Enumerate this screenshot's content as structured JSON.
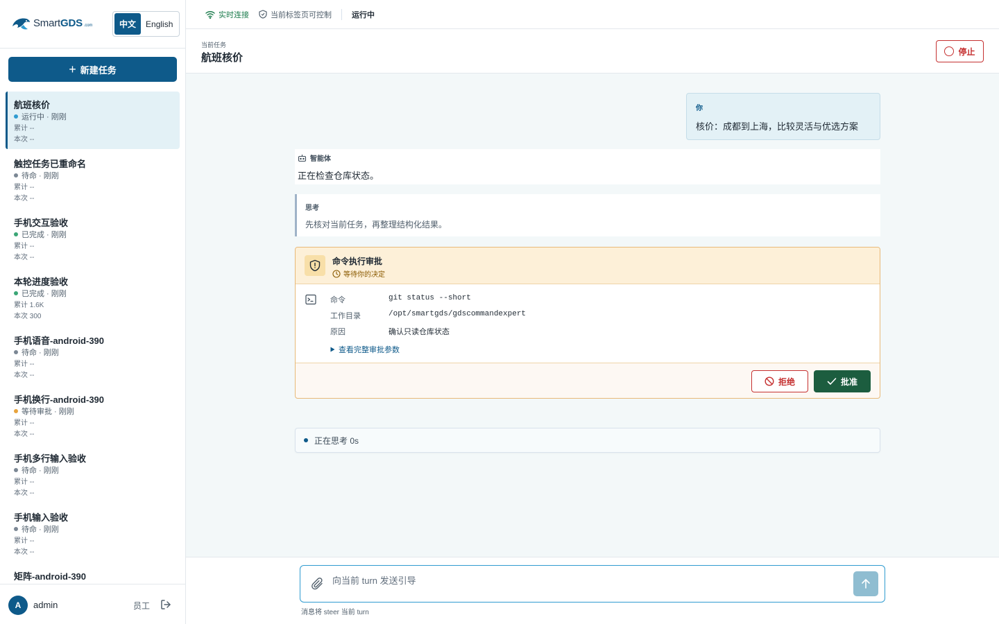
{
  "brand": {
    "name_prefix": "Smart",
    "name_bold": "GDS",
    "name_suffix": ".com"
  },
  "lang": {
    "zh": "中文",
    "en": "English"
  },
  "sidebar": {
    "new_task_label": "新建任务",
    "tasks": [
      {
        "title": "航班核价",
        "status": "运行中 · 刚刚",
        "status_color": "#2f9bd0",
        "total": "累计 --",
        "current": "本次 --"
      },
      {
        "title": "触控任务已重命名",
        "status": "待命 · 刚刚",
        "status_color": "#7b8794",
        "total": "累计 --",
        "current": "本次 --"
      },
      {
        "title": "手机交互验收",
        "status": "已完成 · 刚刚",
        "status_color": "#3ba676",
        "total": "累计 --",
        "current": "本次 --"
      },
      {
        "title": "本轮进度验收",
        "status": "已完成 · 刚刚",
        "status_color": "#3ba676",
        "total": "累计 1.6K",
        "current": "本次 300"
      },
      {
        "title": "手机语音-android-390",
        "status": "待命 · 刚刚",
        "status_color": "#7b8794",
        "total": "累计 --",
        "current": "本次 --"
      },
      {
        "title": "手机换行-android-390",
        "status": "等待审批 · 刚刚",
        "status_color": "#e8a33d",
        "total": "累计 --",
        "current": "本次 --"
      },
      {
        "title": "手机多行输入验收",
        "status": "待命 · 刚刚",
        "status_color": "#7b8794",
        "total": "累计 --",
        "current": "本次 --"
      },
      {
        "title": "手机输入验收",
        "status": "待命 · 刚刚",
        "status_color": "#7b8794",
        "total": "累计 --",
        "current": "本次 --"
      },
      {
        "title": "矩阵-android-390",
        "status": "",
        "status_color": "#7b8794",
        "total": "",
        "current": ""
      }
    ]
  },
  "user": {
    "avatar": "A",
    "name": "admin",
    "role": "员工"
  },
  "topbar": {
    "connection": "实时连接",
    "control": "当前标签页可控制",
    "state": "运行中"
  },
  "header": {
    "label": "当前任务",
    "title": "航班核价",
    "stop_label": "停止"
  },
  "chat": {
    "user_label": "你",
    "user_text": "核价：成都到上海，比较灵活与优选方案",
    "agent_label": "智能体",
    "agent_text": "正在检查仓库状态。",
    "think_label": "思考",
    "think_text": "先核对当前任务，再整理结构化结果。"
  },
  "approval": {
    "title": "命令执行审批",
    "subtitle": "等待你的决定",
    "command_key": "命令",
    "command_val": "git status --short",
    "cwd_key": "工作目录",
    "cwd_val": "/opt/smartgds/gdscommandexpert",
    "reason_key": "原因",
    "reason_val": "确认只读仓库状态",
    "more_label": "查看完整审批参数",
    "reject_label": "拒绝",
    "approve_label": "批准"
  },
  "status": {
    "thinking": "正在思考 0s"
  },
  "composer": {
    "placeholder": "向当前 turn 发送引导",
    "hint": "消息将 steer 当前 turn"
  },
  "colors": {
    "primary": "#0e5a8a",
    "danger": "#c53030",
    "success": "#1c5d3f",
    "warning": "#e8a33d"
  }
}
